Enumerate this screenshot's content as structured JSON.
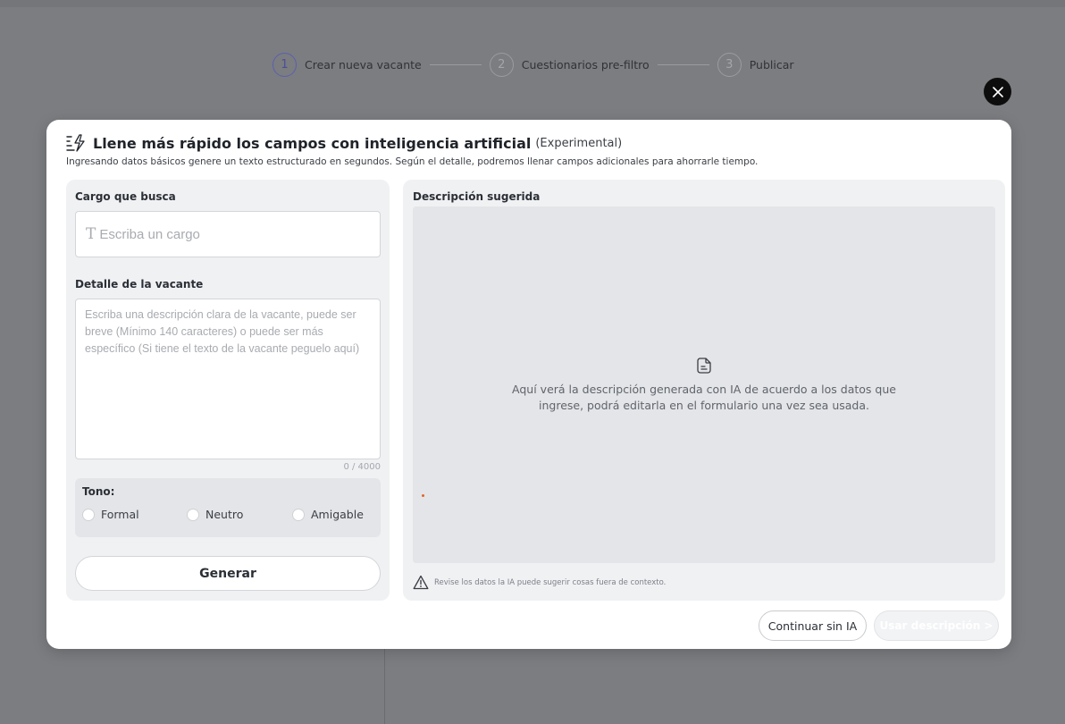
{
  "stepper": {
    "steps": [
      {
        "num": "1",
        "label": "Crear nueva vacante"
      },
      {
        "num": "2",
        "label": "Cuestionarios pre-filtro"
      },
      {
        "num": "3",
        "label": "Publicar"
      }
    ],
    "active_step": 1
  },
  "modal": {
    "title": "Llene más rápido los campos con inteligencia artificial",
    "title_tag": "(Experimental)",
    "subtitle": "Ingresando datos básicos genere un texto estructurado en segundos. Según el detalle, podremos llenar campos adicionales para ahorrarle tiempo.",
    "icons": {
      "title": "ai-sparkle-form-icon",
      "close": "close-icon"
    }
  },
  "form": {
    "cargo_label": "Cargo que busca",
    "cargo_placeholder": "Escriba un cargo",
    "cargo_value": "",
    "detalle_label": "Detalle de la vacante",
    "detalle_placeholder": "Escriba una descripción clara de la vacante, puede ser breve (Mínimo 140 caracteres) o puede ser más específico (Si tiene el texto de la vacante peguelo aquí)",
    "detalle_value": "",
    "counter": "0 / 4000",
    "tono_label": "Tono:",
    "tono_options": [
      "Formal",
      "Neutro",
      "Amigable"
    ],
    "generar_label": "Generar"
  },
  "sugerida": {
    "label": "Descripción sugerida",
    "empty_message": "Aquí verá la descripción generada con IA de acuerdo a los datos que ingrese, podrá editarla en el formulario una vez sea usada.",
    "warning": "Revise los datos la IA puede sugerir cosas fuera de contexto."
  },
  "footer": {
    "continuar_label": "Continuar sin IA",
    "usar_label": "Usar descripción >"
  },
  "colors": {
    "backdrop": "#7b7d80",
    "active_step": "#5b5fb0",
    "panel": "#f0f1f3",
    "accent_dot": "#e0642a"
  }
}
